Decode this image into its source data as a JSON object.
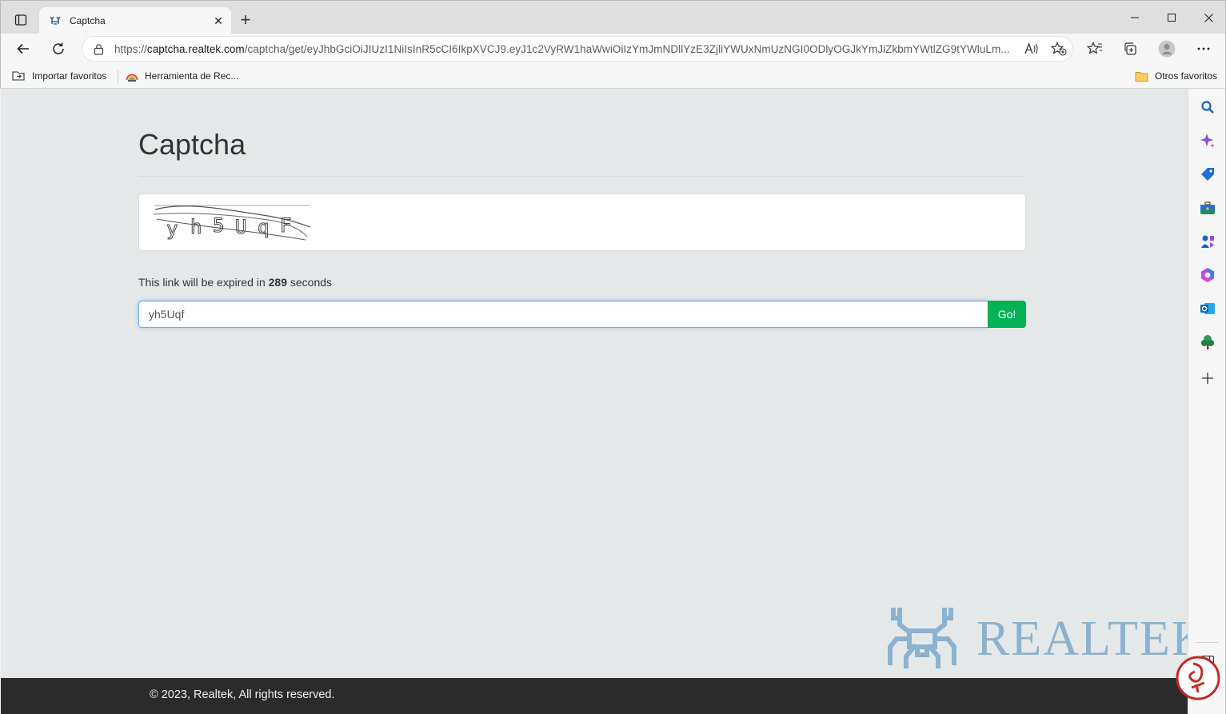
{
  "browser": {
    "tab": {
      "title": "Captcha",
      "close": "✕"
    },
    "new_tab": "+",
    "address": {
      "scheme": "https://",
      "host": "captcha.realtek.com",
      "path": "/captcha/get/eyJhbGciOiJIUzI1NiIsInR5cCI6IkpXVCJ9.eyJ1c2VyRW1haWwiOiIzYmJmNDllYzE3ZjliYWUxNmUzNGI0ODlyOGJkYmJiZkbmYWtlZG9tYWluLm..."
    },
    "bookmarks": [
      {
        "label": "Importar favoritos"
      },
      {
        "label": "Herramienta de Rec..."
      }
    ],
    "other_favorites": "Otros favoritos",
    "sidebar_icons": [
      "search-icon",
      "copilot-icon",
      "shopping-tag-icon",
      "tools-briefcase-icon",
      "games-icon",
      "office-icon",
      "outlook-icon",
      "tree-icon",
      "add-icon"
    ]
  },
  "page": {
    "title": "Captcha",
    "captcha_chars": [
      "y",
      "h",
      "5",
      "U",
      "q",
      "F"
    ],
    "expire_prefix": "This link will be expired in ",
    "expire_seconds": "289",
    "expire_suffix": " seconds",
    "input_value": "yh5Uqf",
    "go_label": "Go!",
    "brand": "REALTEK",
    "footer": "© 2023, Realtek, All rights reserved."
  },
  "colors": {
    "go_button": "#00b454",
    "page_bg": "#e5e8e9",
    "footer_bg": "#2b2b2b",
    "logo": "#8bb3cf"
  }
}
